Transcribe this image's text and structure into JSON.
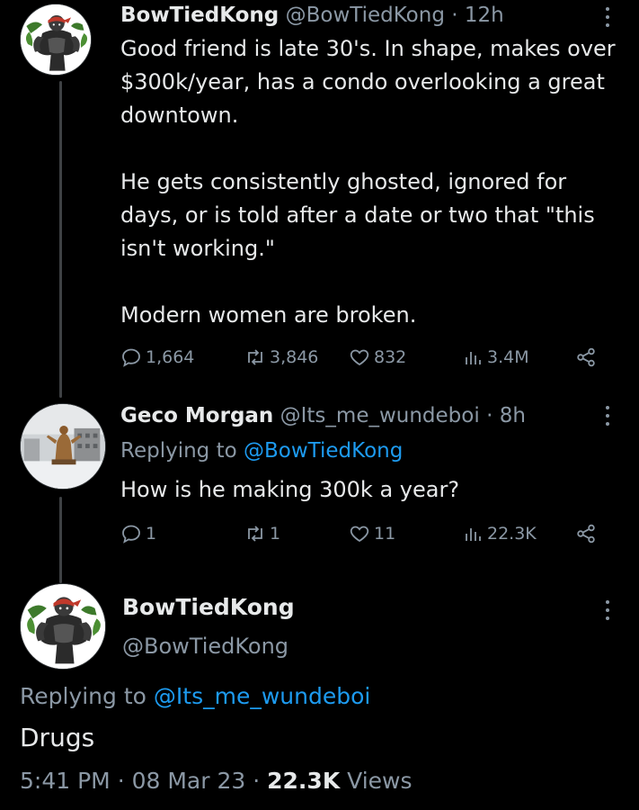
{
  "tweet1": {
    "name": "BowTiedKong",
    "handle": "@BowTiedKong",
    "time": "12h",
    "paragraphs": [
      "Good friend is late 30's. In shape, makes over $300k/year, has a condo overlooking a great downtown.",
      "He gets consistently ghosted, ignored for days, or is told after a date or two that \"this isn't working.\"",
      "Modern women are broken."
    ],
    "replies": "1,664",
    "retweets": "3,846",
    "likes": "832",
    "views": "3.4M"
  },
  "tweet2": {
    "name": "Geco Morgan",
    "handle": "@Its_me_wundeboi",
    "time": "8h",
    "replying_label": "Replying to",
    "replying_handle": "@BowTiedKong",
    "text": "How is he making 300k a year?",
    "replies": "1",
    "retweets": "1",
    "likes": "11",
    "views": "22.3K"
  },
  "main": {
    "name": "BowTiedKong",
    "handle": "@BowTiedKong",
    "replying_label": "Replying to",
    "replying_handle": "@Its_me_wundeboi",
    "text": "Drugs",
    "time": "5:41 PM",
    "date": "08 Mar 23",
    "views_count": "22.3K",
    "views_label": "Views"
  },
  "separator": "·",
  "icons": {
    "reply": "reply-icon",
    "retweet": "retweet-icon",
    "like": "heart-icon",
    "views": "views-icon",
    "share": "share-icon",
    "more": "more-icon"
  },
  "colors": {
    "background": "#000000",
    "text": "#e7e9ea",
    "secondary": "#8b98a5",
    "link": "#1d9bf0"
  }
}
